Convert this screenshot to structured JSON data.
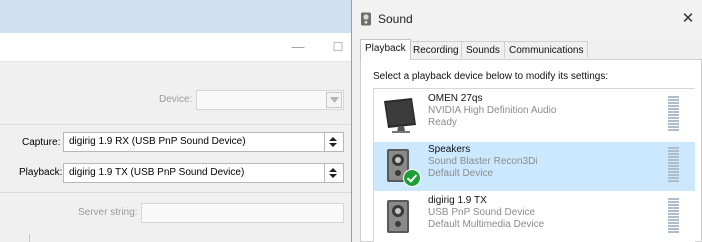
{
  "left_window": {
    "minimize_glyph": "—",
    "maximize_glyph": "☐",
    "device_label": "Device:",
    "capture_label": "Capture:",
    "capture_value": "digirig 1.9 RX (USB PnP Sound Device)",
    "playback_label": "Playback:",
    "playback_value": "digirig 1.9 TX (USB PnP Sound Device)",
    "server_string_label": "Server string:"
  },
  "sound_dialog": {
    "title": "Sound",
    "close_glyph": "✕",
    "tabs": [
      "Playback",
      "Recording",
      "Sounds",
      "Communications"
    ],
    "active_tab": "Playback",
    "instruction": "Select a playback device below to modify its settings:",
    "devices": [
      {
        "name": "OMEN 27qs",
        "line2": "NVIDIA High Definition Audio",
        "line3": "Ready",
        "icon": "monitor-icon",
        "selected": false,
        "default": false
      },
      {
        "name": "Speakers",
        "line2": "Sound Blaster Recon3Di",
        "line3": "Default Device",
        "icon": "speaker-icon",
        "selected": true,
        "default": true
      },
      {
        "name": "digirig 1.9 TX",
        "line2": "USB PnP Sound Device",
        "line3": "Default Multimedia Device",
        "icon": "speaker-icon",
        "selected": false,
        "default": false
      }
    ]
  },
  "colors": {
    "selected_row": "#cce8ff",
    "default_check": "#1e9e36",
    "meter": "#aebdc9"
  }
}
